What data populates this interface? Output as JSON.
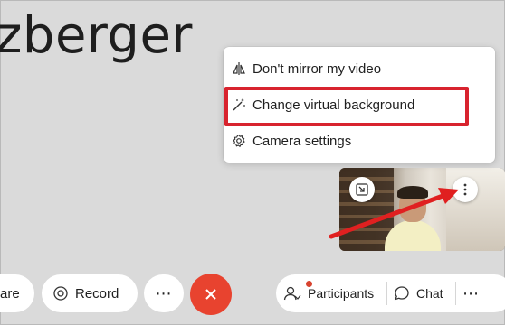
{
  "meeting": {
    "participant_name": "zberger"
  },
  "menu": {
    "items": [
      {
        "label": "Don't mirror my video",
        "icon": "mirror-icon"
      },
      {
        "label": "Change virtual background",
        "icon": "magic-wand-icon"
      },
      {
        "label": "Camera settings",
        "icon": "gear-icon"
      }
    ]
  },
  "self_view": {
    "pip_icon": "picture-in-picture-icon",
    "more_icon": "more-vertical-icon"
  },
  "toolbar": {
    "share_label": "are",
    "record_label": "Record",
    "more_label": "⋯",
    "end_icon": "close-icon",
    "participants_label": "Participants",
    "chat_label": "Chat",
    "more2_label": "⋯"
  },
  "colors": {
    "highlight": "#d8232e",
    "end_call": "#e8432f",
    "arrow": "#e02020"
  }
}
